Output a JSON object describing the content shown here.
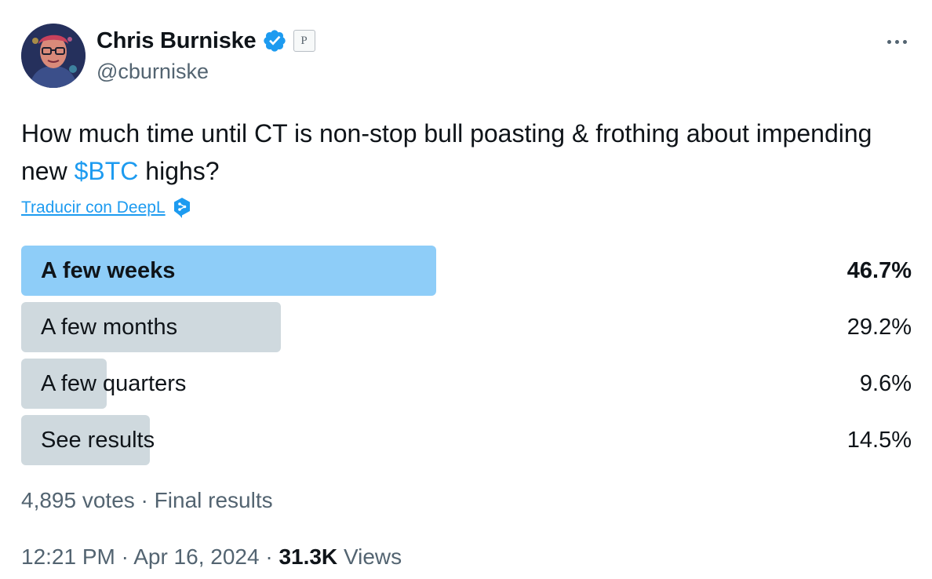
{
  "author": {
    "display_name": "Chris Burniske",
    "handle": "@cburniske",
    "affiliate_badge": "P",
    "avatar_icon": "profile-portrait",
    "verified_icon": "verified-badge-icon"
  },
  "tweet": {
    "text_before": "How much time until CT is non-stop bull poasting & frothing about impending new ",
    "cashtag": "$BTC",
    "text_after": " highs?",
    "translate_label": "Traducir con DeepL",
    "translate_icon": "deepl-logo-icon"
  },
  "poll": {
    "options": [
      {
        "label": "A few weeks",
        "percent_text": "46.7%",
        "percent": 46.7,
        "winner": true
      },
      {
        "label": "A few months",
        "percent_text": "29.2%",
        "percent": 29.2,
        "winner": false
      },
      {
        "label": "A few quarters",
        "percent_text": "9.6%",
        "percent": 9.6,
        "winner": false
      },
      {
        "label": "See results",
        "percent_text": "14.5%",
        "percent": 14.5,
        "winner": false
      }
    ],
    "votes_text": "4,895 votes",
    "separator": " · ",
    "status_text": "Final results"
  },
  "meta": {
    "time": "12:21 PM",
    "separator": " · ",
    "date": "Apr 16, 2024",
    "views_count": "31.3K",
    "views_label": "Views"
  },
  "colors": {
    "accent": "#1d9bf0",
    "winner_bar": "#8ecdf8",
    "bar": "#cfd9de",
    "secondary_text": "#536471",
    "primary_text": "#0f1419"
  }
}
